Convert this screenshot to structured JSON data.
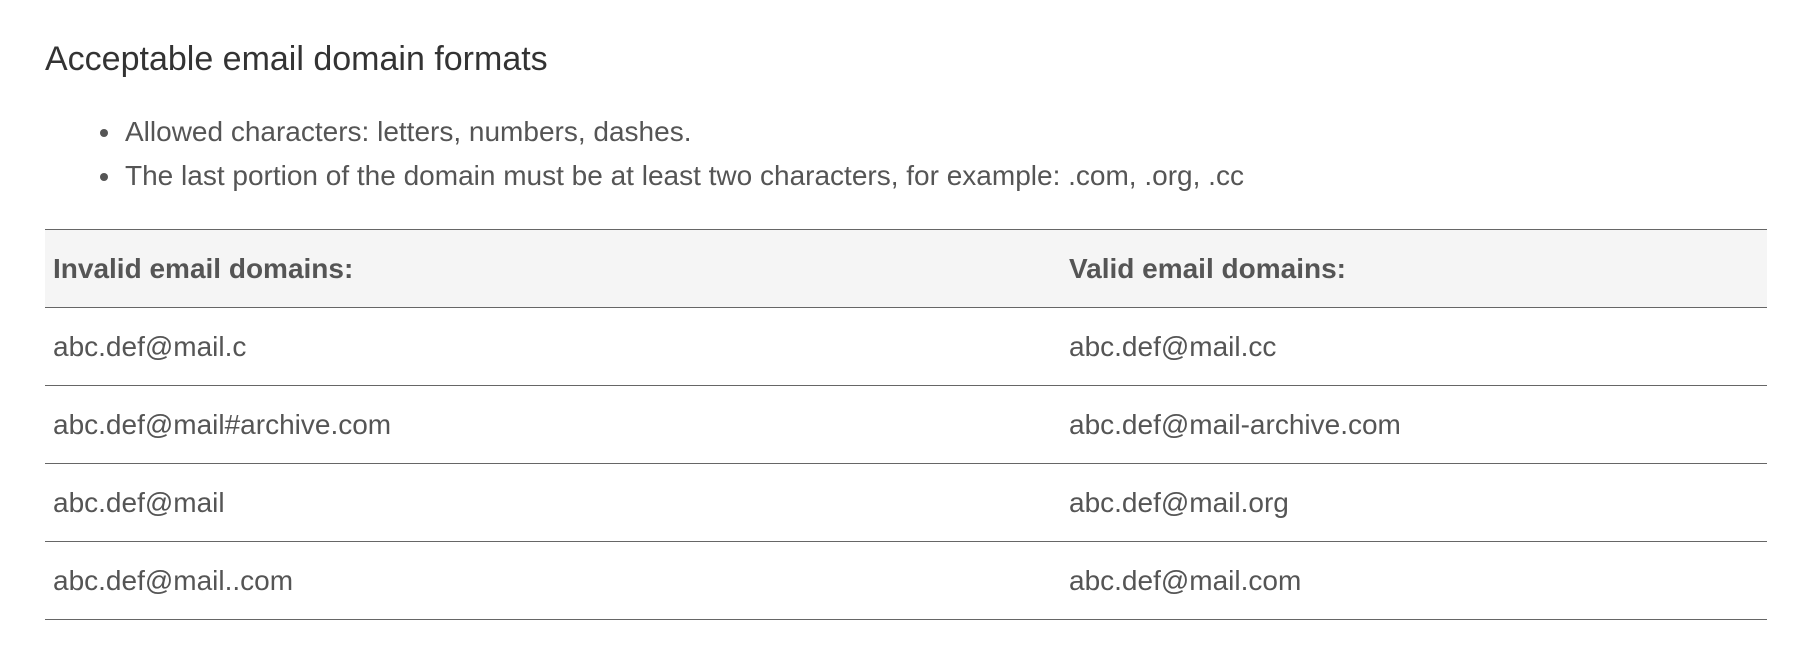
{
  "section": {
    "title": "Acceptable email domain formats"
  },
  "rules": [
    "Allowed characters: letters, numbers, dashes.",
    "The last portion of the domain must be at least two characters, for example: .com, .org, .cc"
  ],
  "table": {
    "headers": [
      "Invalid email domains:",
      "Valid email domains:"
    ],
    "rows": [
      [
        "abc.def@mail.c",
        "abc.def@mail.cc"
      ],
      [
        "abc.def@mail#archive.com",
        "abc.def@mail-archive.com"
      ],
      [
        "abc.def@mail",
        "abc.def@mail.org"
      ],
      [
        "abc.def@mail..com",
        "abc.def@mail.com"
      ]
    ]
  }
}
